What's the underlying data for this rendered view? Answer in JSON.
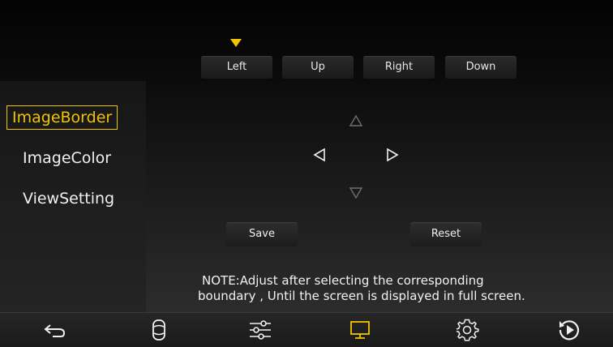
{
  "tabs": {
    "items": [
      {
        "label": "Left",
        "selected": true
      },
      {
        "label": "Up",
        "selected": false
      },
      {
        "label": "Right",
        "selected": false
      },
      {
        "label": "Down",
        "selected": false
      }
    ]
  },
  "sidebar": {
    "items": [
      {
        "label": "ImageBorder",
        "active": true
      },
      {
        "label": "ImageColor",
        "active": false
      },
      {
        "label": "ViewSetting",
        "active": false
      }
    ]
  },
  "controls": {
    "arrows": [
      "up-arrow-icon",
      "left-arrow-icon",
      "right-arrow-icon",
      "down-arrow-icon"
    ],
    "save_label": "Save",
    "reset_label": "Reset"
  },
  "note": {
    "line1": "NOTE:Adjust after selecting the corresponding",
    "line2": "boundary , Until the screen is displayed in full screen."
  },
  "bottom_nav": {
    "icons": [
      "back-icon",
      "car-icon",
      "sliders-icon",
      "display-icon",
      "gear-icon",
      "replay-icon"
    ],
    "active": "display-icon"
  },
  "colors": {
    "accent": "#f2c400",
    "text": "#f0f0f0",
    "background": "#000000"
  }
}
